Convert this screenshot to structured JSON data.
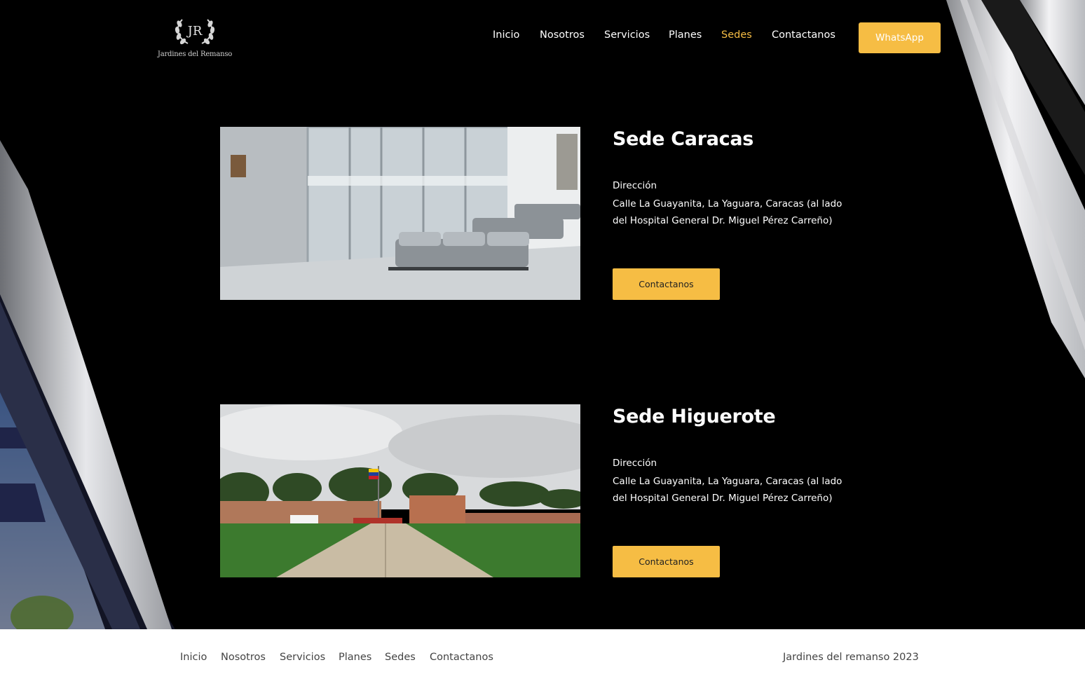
{
  "brand": {
    "monogram": "JR",
    "name": "Jardines del Remanso"
  },
  "nav": {
    "items": [
      {
        "label": "Inicio"
      },
      {
        "label": "Nosotros"
      },
      {
        "label": "Servicios"
      },
      {
        "label": "Planes"
      },
      {
        "label": "Sedes"
      },
      {
        "label": "Contactanos"
      }
    ],
    "active": "Sedes",
    "whatsapp_label": "WhatsApp"
  },
  "sedes": [
    {
      "title": "Sede Caracas",
      "address_label": "Dirección",
      "address": "Calle La Guayanita, La Yaguara, Caracas (al lado del Hospital General Dr. Miguel Pérez Carreño)",
      "button": "Contactanos"
    },
    {
      "title": "Sede Higuerote",
      "address_label": "Dirección",
      "address": "Calle La Guayanita, La Yaguara, Caracas (al lado del Hospital General Dr. Miguel Pérez Carreño)",
      "button": "Contactanos"
    }
  ],
  "footer": {
    "nav": [
      {
        "label": "Inicio"
      },
      {
        "label": "Nosotros"
      },
      {
        "label": "Servicios"
      },
      {
        "label": "Planes"
      },
      {
        "label": "Sedes"
      },
      {
        "label": "Contactanos"
      }
    ],
    "copyright": "Jardines del remanso 2023"
  },
  "colors": {
    "accent": "#f6bd44",
    "background": "#000000",
    "footer_bg": "#ffffff"
  }
}
